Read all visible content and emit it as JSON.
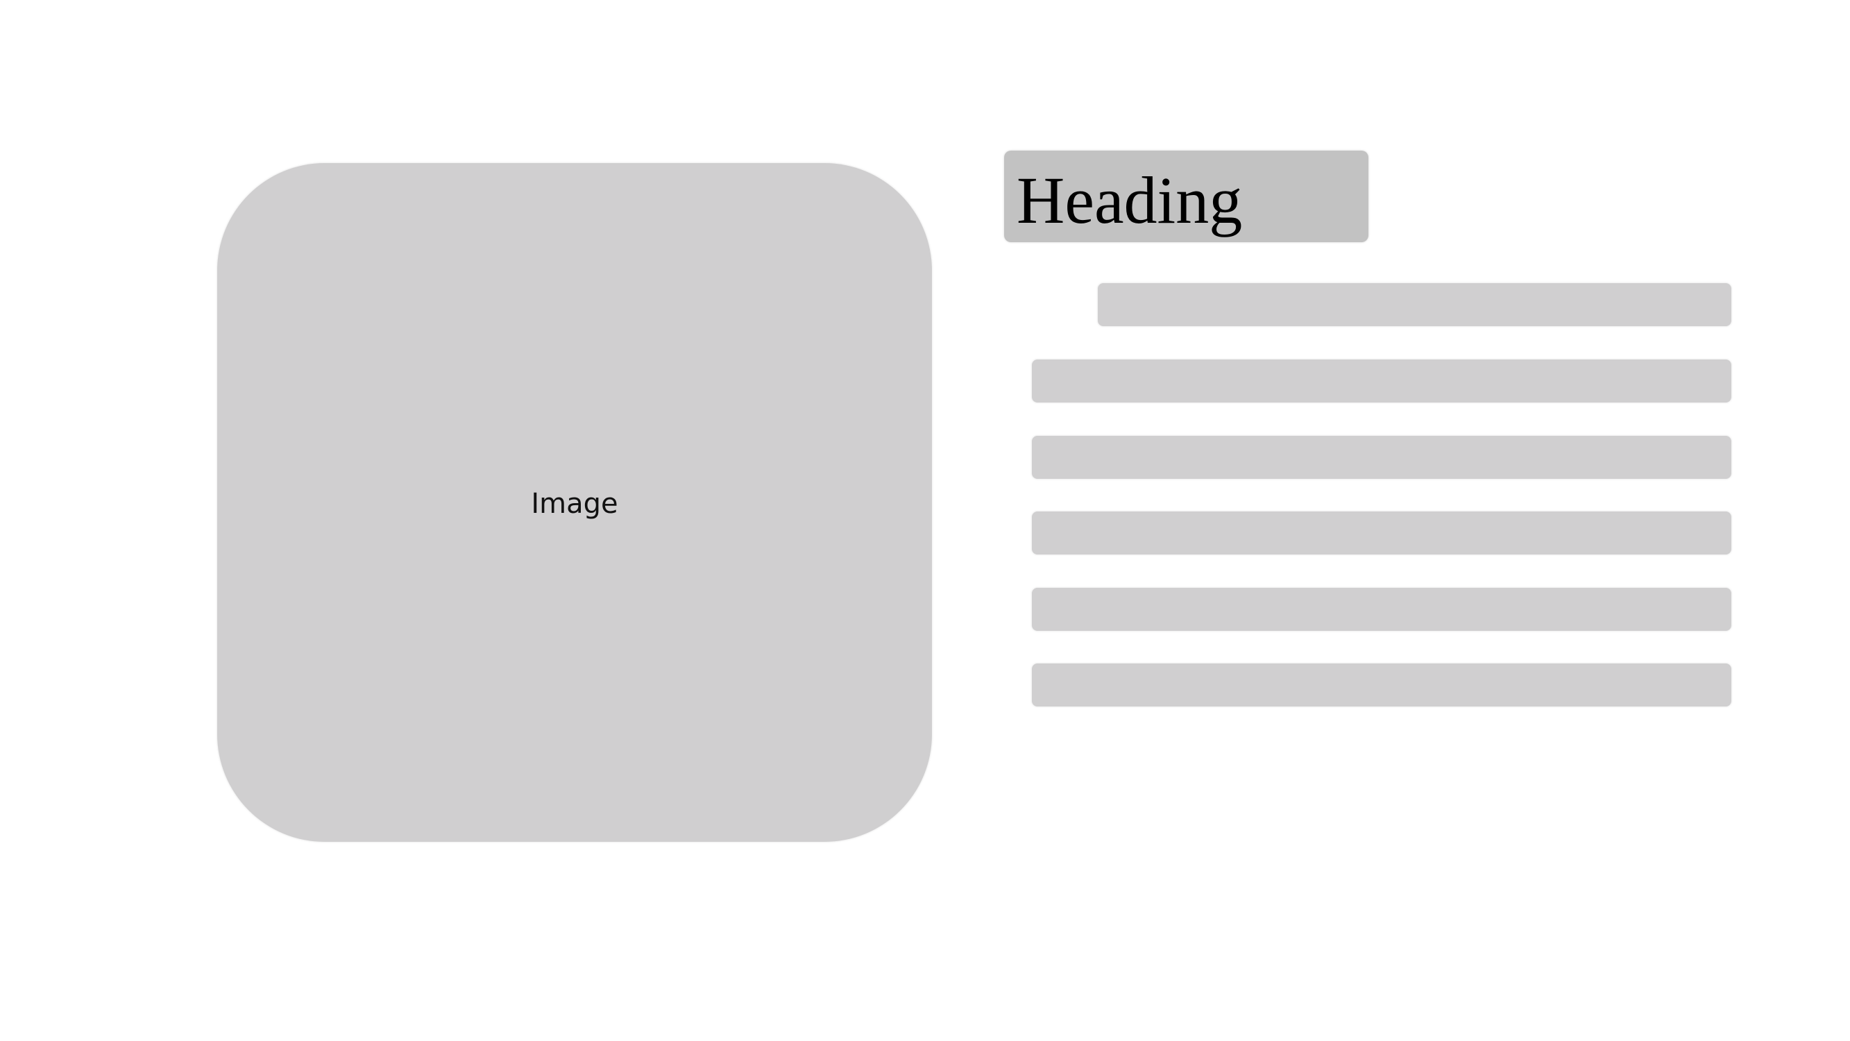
{
  "image_placeholder": {
    "label": "Image"
  },
  "heading": {
    "text": "Heading"
  },
  "text_lines": 6
}
